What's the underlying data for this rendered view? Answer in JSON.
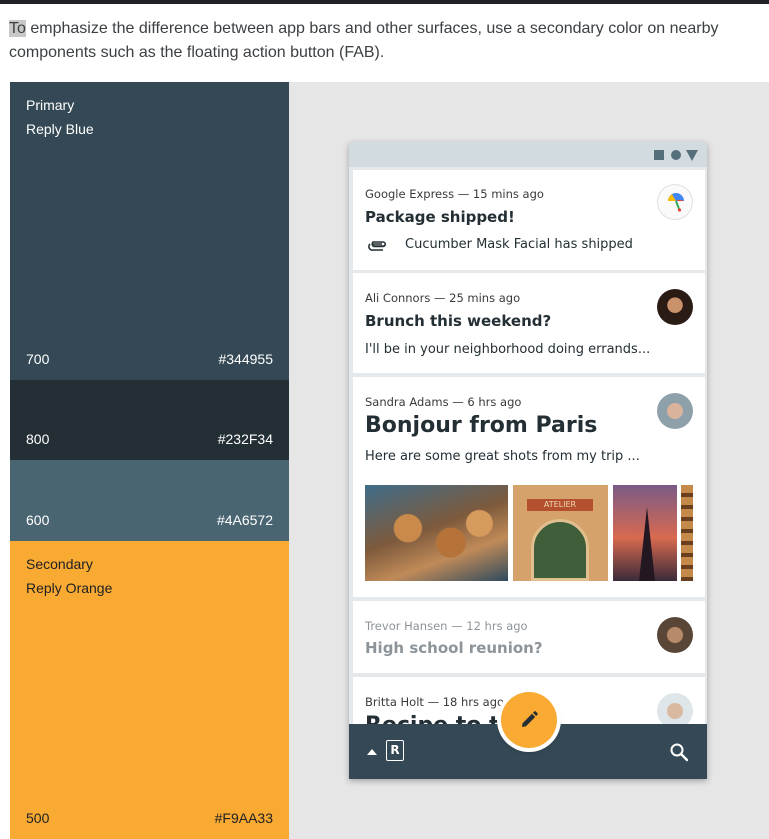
{
  "intro": {
    "highlight": "To",
    "rest": " emphasize the difference between app bars and other surfaces, use a secondary color on nearby components such as the floating action button (FAB)."
  },
  "swatches": [
    {
      "group": "Primary",
      "name": "Reply Blue",
      "weight": "700",
      "hex": "#344955"
    },
    {
      "weight": "800",
      "hex": "#232F34"
    },
    {
      "weight": "600",
      "hex": "#4A6572"
    },
    {
      "group": "Secondary",
      "name": "Reply Orange",
      "weight": "500",
      "hex": "#F9AA33"
    }
  ],
  "colors": {
    "primary_700": "#344955",
    "primary_800": "#232F34",
    "primary_600": "#4A6572",
    "secondary_500": "#F9AA33",
    "page_background": "#E6E6E6"
  },
  "statusbar_icons": [
    "square-icon",
    "circle-icon",
    "triangle-icon"
  ],
  "emails": [
    {
      "meta": "Google Express — 15 mins ago",
      "subject": "Package shipped!",
      "preview": "Cucumber Mask Facial has shipped",
      "preview_icon": "attachment-icon",
      "avatar": "google-express-logo"
    },
    {
      "meta": "Ali Connors — 25 mins ago",
      "subject": "Brunch this weekend?",
      "preview": "I'll be in your neighborhood doing errands...",
      "avatar": "ali-connors-avatar"
    },
    {
      "meta": "Sandra Adams — 6 hrs ago",
      "subject": "Bonjour from Paris",
      "preview": "Here are some great shots from my trip ...",
      "avatar": "sandra-adams-avatar",
      "photo_sign": "ATELIER"
    },
    {
      "meta": "Trevor Hansen — 12 hrs ago",
      "subject": "High school reunion?",
      "avatar": "trevor-hansen-avatar"
    },
    {
      "meta": "Britta Holt — 18 hrs ago",
      "subject": "Recipe to try",
      "avatar": "britta-holt-avatar"
    }
  ],
  "bottom_bar": {
    "menu_icon": "arrow-up-icon",
    "logo": "R",
    "search_icon": "search-icon",
    "fab_icon": "edit-icon"
  }
}
